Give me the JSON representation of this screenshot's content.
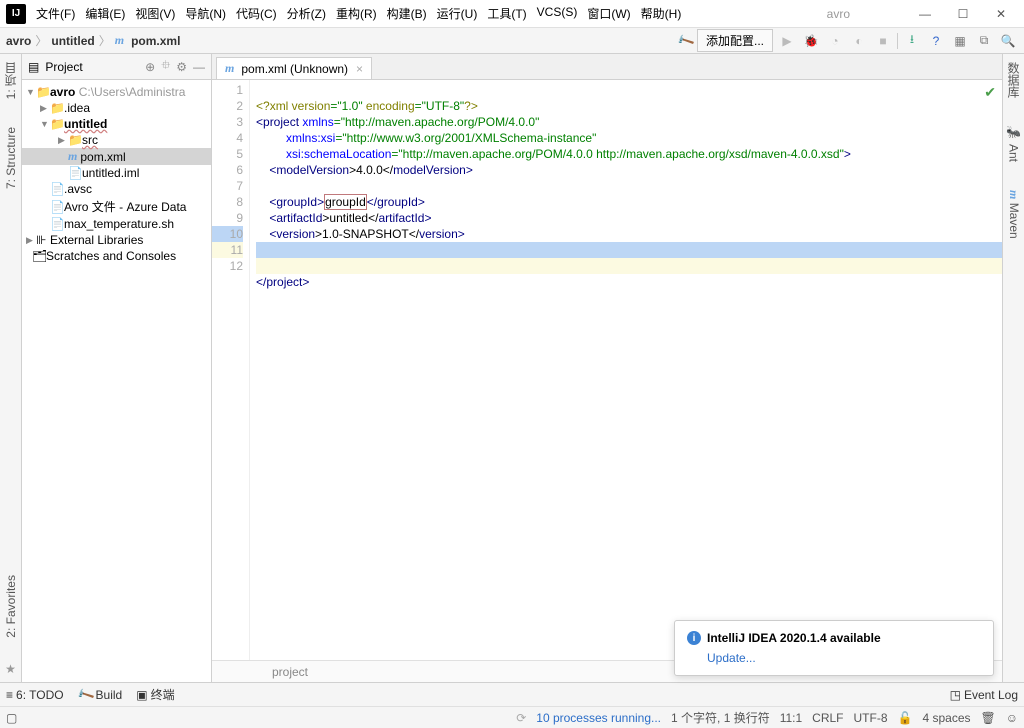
{
  "app": {
    "name": "avro"
  },
  "menu": {
    "file": "文件(F)",
    "edit": "编辑(E)",
    "view": "视图(V)",
    "nav": "导航(N)",
    "code": "代码(C)",
    "analyze": "分析(Z)",
    "refactor": "重构(R)",
    "build": "构建(B)",
    "run": "运行(U)",
    "tools": "工具(T)",
    "vcs": "VCS(S)",
    "window": "窗口(W)",
    "help": "帮助(H)"
  },
  "breadcrumb": {
    "a": "avro",
    "b": "untitled",
    "c": "pom.xml"
  },
  "nav": {
    "addconfig": "添加配置..."
  },
  "leftstrip": {
    "project": "1: 项目",
    "structure": "7: Structure",
    "favorites": "2: Favorites"
  },
  "rightstrip": {
    "database": "数据库",
    "ant": "Ant",
    "maven": "Maven"
  },
  "panel": {
    "title": "Project"
  },
  "tree": {
    "root": "avro",
    "rootpath": "C:\\Users\\Administra",
    "idea": ".idea",
    "untitled": "untitled",
    "src": "src",
    "pom": "pom.xml",
    "iml": "untitled.iml",
    "avsc": ".avsc",
    "avrofile": "Avro 文件 - Azure Data",
    "maxtemp": "max_temperature.sh",
    "extlib": "External Libraries",
    "scratches": "Scratches and Consoles"
  },
  "tab": {
    "label": "pom.xml (Unknown)"
  },
  "editor_breadcrumb": "project",
  "code": {
    "l1_a": "<?",
    "l1_b": "xml version",
    "l1_c": "=\"1.0\"",
    "l1_d": " encoding",
    "l1_e": "=\"UTF-8\"",
    "l1_f": "?>",
    "l2_a": "<",
    "l2_b": "project ",
    "l2_c": "xmlns",
    "l2_d": "=\"http://maven.apache.org/POM/4.0.0\"",
    "l3_a": "xmlns:xsi",
    "l3_b": "=\"http://www.w3.org/2001/XMLSchema-instance\"",
    "l4_a": "xsi:schemaLocation",
    "l4_b": "=\"http://maven.apache.org/POM/4.0.0 http://maven.apache.org/xsd/maven-4.0.0.xsd\"",
    "l4_c": ">",
    "l5_a": "<",
    "l5_b": "modelVersion",
    "l5_c": ">4.0.0</",
    "l5_d": "modelVersion",
    "l5_e": ">",
    "l7_a": "<",
    "l7_b": "groupId",
    "l7_c": ">",
    "l7_d": "groupId",
    "l7_e": "</",
    "l7_f": "groupId",
    "l7_g": ">",
    "l8_a": "<",
    "l8_b": "artifactId",
    "l8_c": ">untitled</",
    "l8_d": "artifactId",
    "l8_e": ">",
    "l9_a": "<",
    "l9_b": "version",
    "l9_c": ">1.0-SNAPSHOT</",
    "l9_d": "version",
    "l9_e": ">",
    "l12_a": "</",
    "l12_b": "project",
    "l12_c": ">"
  },
  "lines": {
    "1": "1",
    "2": "2",
    "3": "3",
    "4": "4",
    "5": "5",
    "6": "6",
    "7": "7",
    "8": "8",
    "9": "9",
    "10": "10",
    "11": "11",
    "12": "12"
  },
  "bottom": {
    "todo": "6: TODO",
    "build": "Build",
    "terminal": "终端",
    "eventlog": "Event Log"
  },
  "status": {
    "processes": "10 processes running...",
    "chars": "1 个字符, 1 换行符",
    "pos": "11:1",
    "eol": "CRLF",
    "enc": "UTF-8",
    "indent": "4 spaces"
  },
  "notif": {
    "title": "IntelliJ IDEA 2020.1.4 available",
    "link": "Update..."
  }
}
